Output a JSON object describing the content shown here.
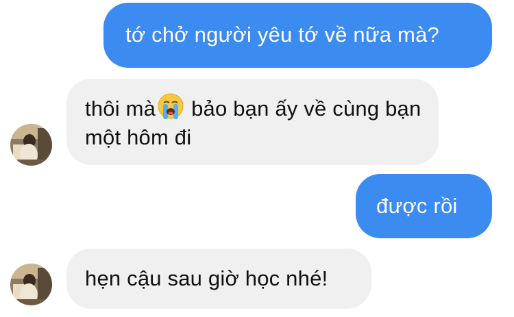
{
  "messages": [
    {
      "id": "m1",
      "direction": "sent",
      "text": "tớ chở người yêu tớ về nữa mà?"
    },
    {
      "id": "m2",
      "direction": "received",
      "text_before_emoji": "thôi mà",
      "emoji": "loudly-crying-face",
      "text_after_emoji": "bảo bạn ấy về cùng bạn một hôm đi"
    },
    {
      "id": "m3",
      "direction": "sent",
      "text": "được rồi"
    },
    {
      "id": "m4",
      "direction": "received",
      "text": "hẹn cậu sau giờ học nhé!"
    }
  ],
  "colors": {
    "sent_bubble": "#3b8bf0",
    "received_bubble": "#f0f0f0",
    "sent_text": "#ffffff",
    "received_text": "#111111"
  }
}
